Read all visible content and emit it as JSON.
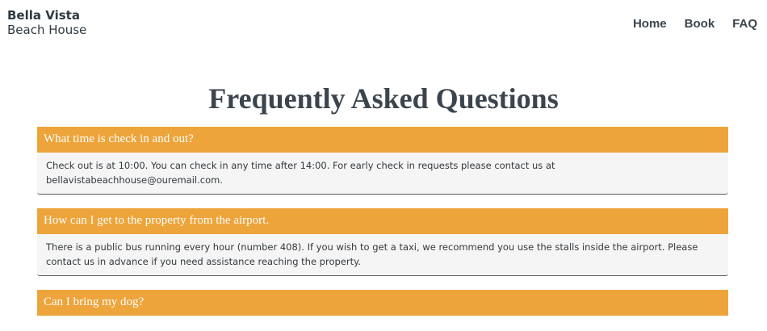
{
  "brand": {
    "name": "Bella Vista",
    "subtitle": "Beach House"
  },
  "nav": {
    "items": [
      {
        "label": "Home"
      },
      {
        "label": "Book"
      },
      {
        "label": "FAQ"
      }
    ]
  },
  "page": {
    "title": "Frequently Asked Questions"
  },
  "faq": [
    {
      "question": "What time is check in and out?",
      "answer": "Check out is at 10:00. You can check in any time after 14:00. For early check in requests please contact us at bellavistabeachhouse@ouremail.com.",
      "expanded": true
    },
    {
      "question": "How can I get to the property from the airport.",
      "answer": "There is a public bus running every hour (number 408). If you wish to get a taxi, we recommend you use the stalls inside the airport. Please contact us in advance if you need assistance reaching the property.",
      "expanded": true
    },
    {
      "question": "Can I bring my dog?",
      "answer": "",
      "expanded": false
    }
  ],
  "colors": {
    "accent": "#eda43b",
    "text": "#3c454d",
    "answer_bg": "#f5f5f5"
  }
}
